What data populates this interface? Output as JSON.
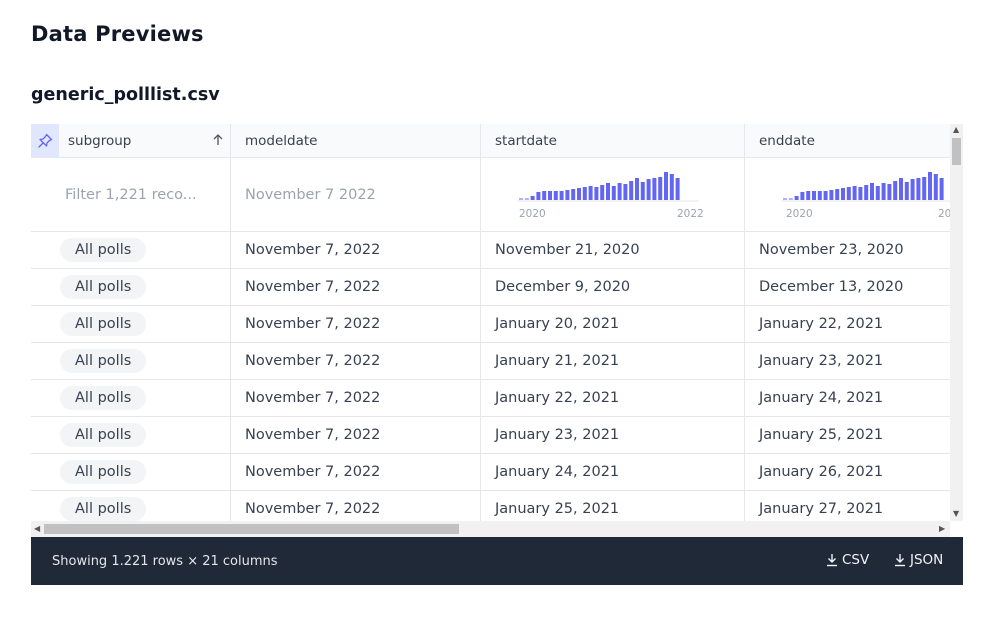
{
  "page": {
    "title": "Data Previews",
    "file_name": "generic_polllist.csv"
  },
  "columns": [
    "subgroup",
    "modeldate",
    "startdate",
    "enddate"
  ],
  "summary": {
    "filter_placeholder": "Filter 1,221 reco...",
    "modeldate": "November 7 2022",
    "startdate_hist": {
      "min_label": "2020",
      "max_label": "2022"
    },
    "enddate_hist": {
      "min_label": "2020",
      "max_label": "20"
    }
  },
  "rows": [
    {
      "subgroup": "All polls",
      "modeldate": "November 7, 2022",
      "startdate": "November 21, 2020",
      "enddate": "November 23, 2020"
    },
    {
      "subgroup": "All polls",
      "modeldate": "November 7, 2022",
      "startdate": "December 9, 2020",
      "enddate": "December 13, 2020"
    },
    {
      "subgroup": "All polls",
      "modeldate": "November 7, 2022",
      "startdate": "January 20, 2021",
      "enddate": "January 22, 2021"
    },
    {
      "subgroup": "All polls",
      "modeldate": "November 7, 2022",
      "startdate": "January 21, 2021",
      "enddate": "January 23, 2021"
    },
    {
      "subgroup": "All polls",
      "modeldate": "November 7, 2022",
      "startdate": "January 22, 2021",
      "enddate": "January 24, 2021"
    },
    {
      "subgroup": "All polls",
      "modeldate": "November 7, 2022",
      "startdate": "January 23, 2021",
      "enddate": "January 25, 2021"
    },
    {
      "subgroup": "All polls",
      "modeldate": "November 7, 2022",
      "startdate": "January 24, 2021",
      "enddate": "January 26, 2021"
    },
    {
      "subgroup": "All polls",
      "modeldate": "November 7, 2022",
      "startdate": "January 25, 2021",
      "enddate": "January 27, 2021"
    }
  ],
  "footer": {
    "info": "Showing 1.221 rows × 21 columns",
    "csv_label": "CSV",
    "json_label": "JSON"
  },
  "icons": {
    "pin": "pin-icon",
    "sort": "arrow-up-icon",
    "download": "download-icon"
  },
  "colors": {
    "accent": "#6366f1",
    "pin_bg": "#e0e7ff",
    "footer_bg": "#1f2937"
  }
}
